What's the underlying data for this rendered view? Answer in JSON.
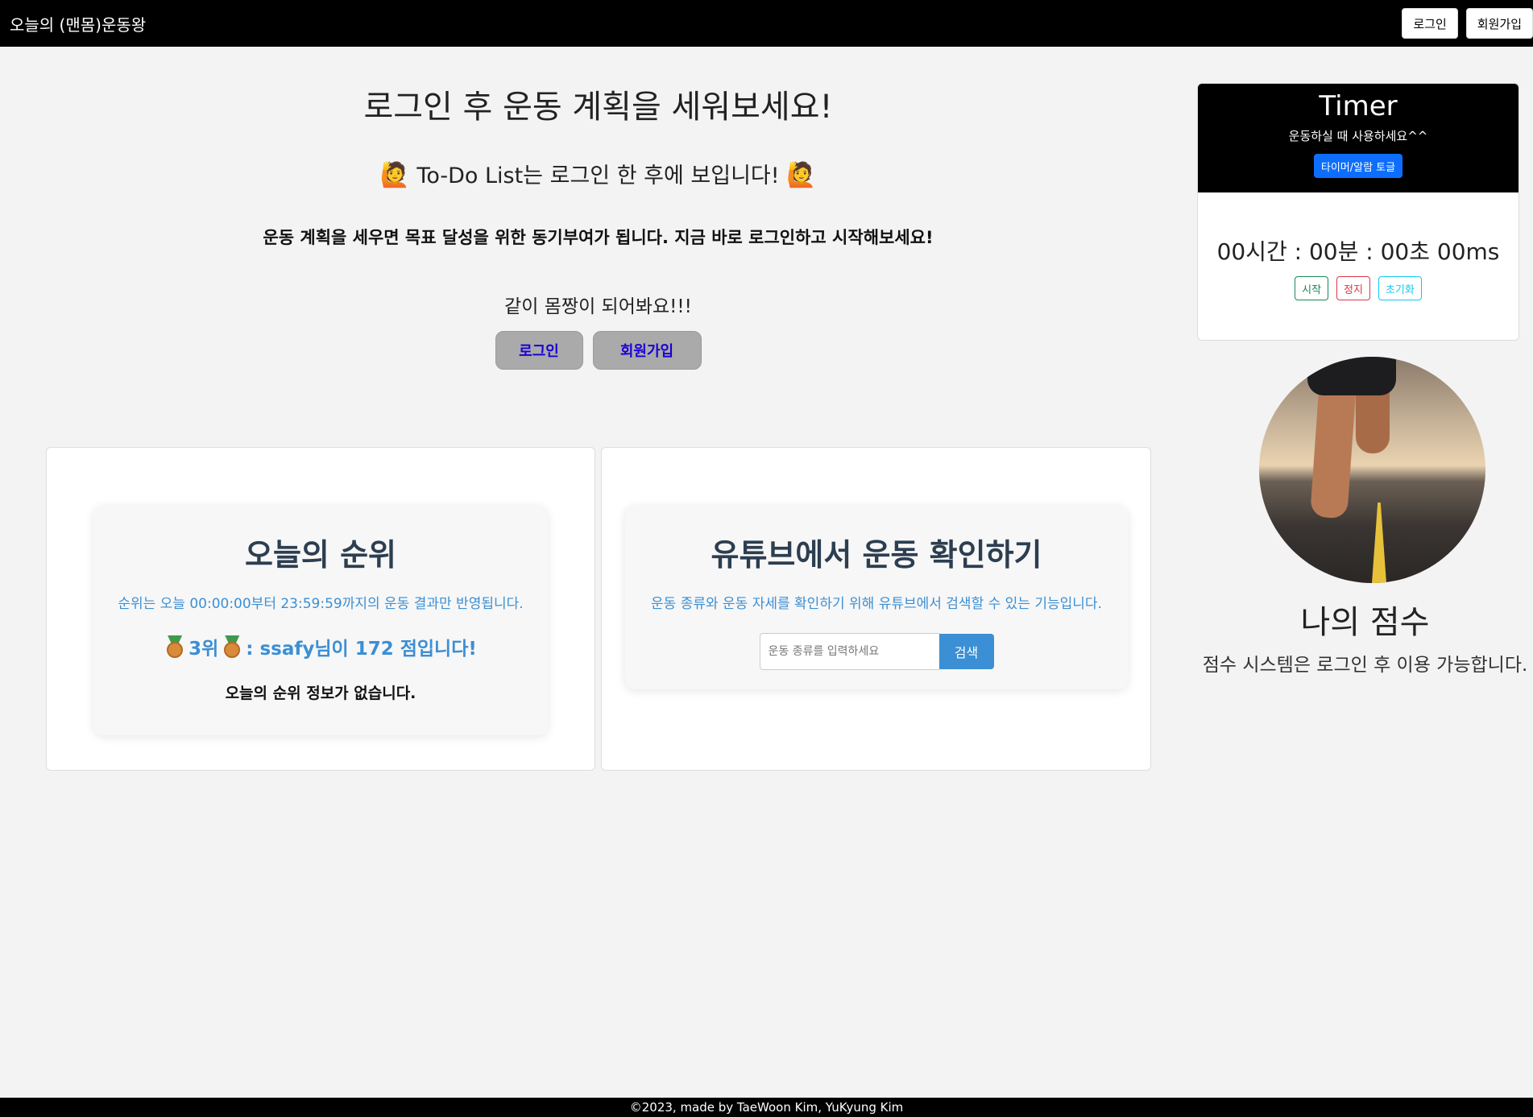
{
  "navbar": {
    "brand": "오늘의 (맨몸)운동왕",
    "login": "로그인",
    "signup": "회원가입"
  },
  "hero": {
    "title": "로그인 후 운동 계획을 세워보세요!",
    "todo_emoji": "🙋",
    "todo_text": "To-Do List는 로그인 한 후에 보입니다!",
    "description": "운동 계획을 세우면 목표 달성을 위한 동기부여가 됩니다. 지금 바로 로그인하고 시작해보세요!",
    "cheer": "같이 몸짱이 되어봐요!!!",
    "login_button": "로그인",
    "signup_button": "회원가입"
  },
  "ranking": {
    "title": "오늘의 순위",
    "subtitle": "순위는 오늘 00:00:00부터 23:59:59까지의 운동 결과만 반영됩니다.",
    "rank_label": "3위",
    "rank_text": ": ssafy님이 172 점입니다!",
    "empty": "오늘의 순위 정보가 없습니다."
  },
  "youtube": {
    "title": "유튜브에서 운동 확인하기",
    "subtitle": "운동 종류와 운동 자세를 확인하기 위해 유튜브에서 검색할 수 있는 기능입니다.",
    "search_placeholder": "운동 종류를 입력하세요",
    "search_button": "검색"
  },
  "timer": {
    "title": "Timer",
    "subtitle": "운동하실 때 사용하세요^^",
    "toggle": "타이머/알람 토글",
    "display": "00시간 : 00분 : 00초 00ms",
    "start": "시작",
    "stop": "정지",
    "reset": "초기화"
  },
  "my_score": {
    "title": "나의 점수",
    "subtitle": "점수 시스템은 로그인 후 이용 가능합니다."
  },
  "footer": {
    "text": "©2023, made by TaeWoon Kim, YuKyung Kim"
  }
}
